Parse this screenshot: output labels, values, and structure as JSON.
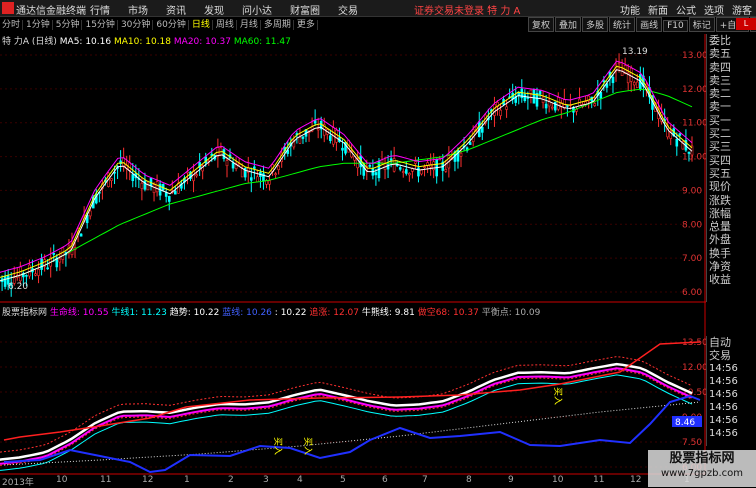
{
  "app": {
    "title": "通达信金融终端",
    "menu": [
      "行情",
      "市场",
      "资讯",
      "发现",
      "问小达",
      "财富圈",
      "交易"
    ],
    "warning": "证券交易未登录  特 力 A",
    "right_menu": [
      "功能",
      "新面",
      "公式",
      "选项"
    ],
    "guest": "游客"
  },
  "periods": [
    "分时",
    "1分钟",
    "5分钟",
    "15分钟",
    "30分钟",
    "60分钟",
    "日线",
    "周线",
    "月线",
    "多周期",
    "更多"
  ],
  "active_period": "日线",
  "right_toolbar": [
    "复权",
    "叠加",
    "多股",
    "统计",
    "画线",
    "F10",
    "标记",
    "+自选",
    "返回"
  ],
  "red_badge": "L",
  "ma_legend": {
    "name": "特 力A (日线)",
    "items": [
      {
        "label": "MA5: 10.16",
        "color": "#ffffff"
      },
      {
        "label": "MA10: 10.18",
        "color": "#ffff00"
      },
      {
        "label": "MA20: 10.37",
        "color": "#ff00ff"
      },
      {
        "label": "MA60: 11.47",
        "color": "#00ff00"
      }
    ]
  },
  "indicator_legend": {
    "name": "股票指标网",
    "items": [
      {
        "label": "生命线: 10.55",
        "color": "#ff00ff"
      },
      {
        "label": "牛线1: 11.23",
        "color": "#00ffff"
      },
      {
        "label": "趋势: 10.22",
        "color": "#ffffff"
      },
      {
        "label": "蓝线: 10.26",
        "color": "#4060ff"
      },
      {
        "label": ": 10.22",
        "color": "#ffffff"
      },
      {
        "label": "追涨: 12.07",
        "color": "#ff3030"
      },
      {
        "label": "牛熊线: 9.81",
        "color": "#ffffff"
      },
      {
        "label": "做空68: 10.37",
        "color": "#ff3030"
      },
      {
        "label": "平衡点: 10.09",
        "color": "#aaaaaa"
      }
    ]
  },
  "price_axis": [
    "13.00",
    "12.00",
    "11.00",
    "10.00",
    "9.00",
    "8.00",
    "7.00",
    "6.00"
  ],
  "indicator_axis": [
    "13.50",
    "12.00",
    "10.50",
    "9.00",
    "7.50",
    "6.00"
  ],
  "annotations": {
    "high": "13.19",
    "low": "6.20",
    "last": "8.46",
    "buy_label": "买入"
  },
  "sidebar": [
    "委比",
    "卖五",
    "卖四",
    "卖三",
    "卖二",
    "卖一",
    "买一",
    "买二",
    "买三",
    "买四",
    "买五",
    "现价",
    "涨跌",
    "涨幅",
    "总量",
    "外盘",
    "换手",
    "净资",
    "收益"
  ],
  "sidebar2": {
    "auto": "自动",
    "trade": "交易",
    "times": [
      "14:56",
      "14:56",
      "14:56",
      "14:56",
      "14:56",
      "14:56",
      "14:56",
      "14:56"
    ]
  },
  "dates": [
    "2013年",
    "10",
    "11",
    "12",
    "1",
    "2",
    "3",
    "4",
    "5",
    "6",
    "7",
    "8",
    "9",
    "10",
    "11",
    "12",
    "1"
  ],
  "watermark": {
    "line1": "股票指标网",
    "line2": "www.7gpzb.com"
  },
  "colors": {
    "up": "#ff3030",
    "down": "#00ffff",
    "ma5": "#ffffff",
    "ma10": "#ffff00",
    "ma20": "#ff00ff",
    "ma60": "#00ff00",
    "blue": "#2030ff"
  },
  "chart_data": {
    "type": "line",
    "title": "特 力A (日线)",
    "ylim": [
      6.0,
      13.5
    ],
    "high": 13.19,
    "low": 6.2,
    "series": [
      {
        "name": "MA5",
        "values": [
          6.3,
          6.5,
          6.8,
          7.2,
          8.8,
          9.8,
          9.2,
          8.9,
          9.5,
          10.1,
          9.6,
          9.4,
          10.5,
          10.9,
          10.4,
          9.5,
          9.8,
          9.6,
          9.7,
          10.4,
          11.3,
          11.8,
          11.7,
          11.4,
          11.6,
          12.6,
          12.2,
          10.8,
          10.16
        ]
      },
      {
        "name": "MA60",
        "values": [
          6.3,
          6.5,
          6.8,
          7.2,
          7.6,
          8.0,
          8.3,
          8.6,
          8.8,
          9.0,
          9.2,
          9.3,
          9.5,
          9.7,
          9.8,
          9.8,
          9.8,
          9.9,
          10.0,
          10.2,
          10.5,
          10.8,
          11.1,
          11.3,
          11.6,
          11.9,
          12.0,
          11.8,
          11.47
        ]
      }
    ]
  }
}
